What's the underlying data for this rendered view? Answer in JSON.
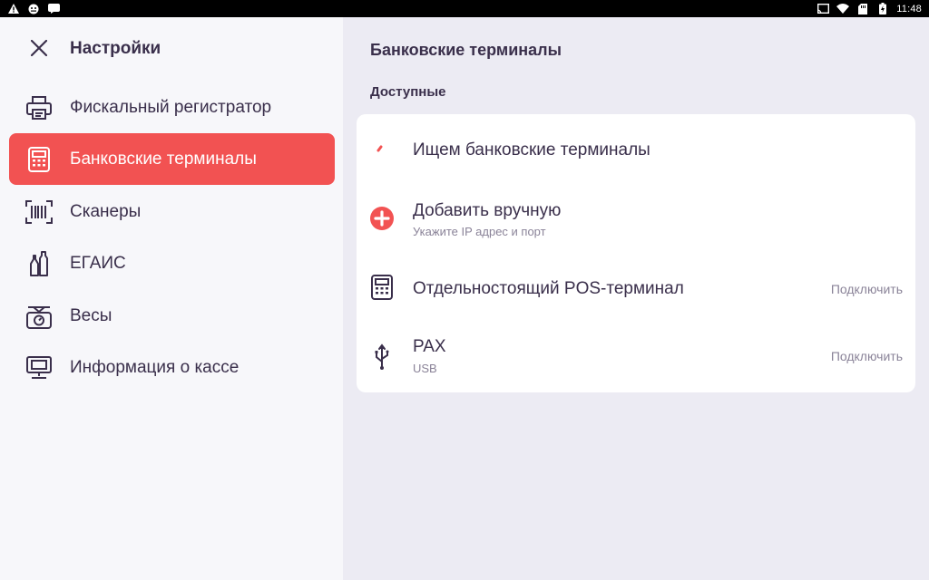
{
  "status_bar": {
    "left_icons": [
      "warning-icon",
      "android-icon",
      "message-icon"
    ],
    "right_icons": [
      "cast-icon",
      "wifi-icon",
      "sd-card-icon",
      "battery-icon"
    ],
    "time": "11:48"
  },
  "sidebar": {
    "title": "Настройки",
    "items": [
      {
        "label": "Фискальный регистратор",
        "icon": "printer-icon",
        "active": false
      },
      {
        "label": "Банковские терминалы",
        "icon": "terminal-icon",
        "active": true
      },
      {
        "label": "Сканеры",
        "icon": "barcode-icon",
        "active": false
      },
      {
        "label": "ЕГАИС",
        "icon": "bottles-icon",
        "active": false
      },
      {
        "label": "Весы",
        "icon": "scales-icon",
        "active": false
      },
      {
        "label": "Информация о кассе",
        "icon": "monitor-icon",
        "active": false
      }
    ]
  },
  "main": {
    "title": "Банковские терминалы",
    "section_label": "Доступные",
    "rows": [
      {
        "title": "Ищем банковские терминалы",
        "icon": "loading-spinner-icon"
      },
      {
        "title": "Добавить вручную",
        "subtitle": "Укажите IP адрес и порт",
        "icon": "add-circle-icon"
      },
      {
        "title": "Отдельностоящий POS-терминал",
        "icon": "terminal-icon",
        "action": "Подключить"
      },
      {
        "title": "PAX",
        "subtitle": "USB",
        "icon": "usb-icon",
        "action": "Подключить"
      }
    ]
  },
  "colors": {
    "accent": "#f25252",
    "text": "#3a2f4b",
    "secondary_text": "#8a8398",
    "main_bg": "#ecebf3",
    "sidebar_bg": "#f7f7fa"
  }
}
